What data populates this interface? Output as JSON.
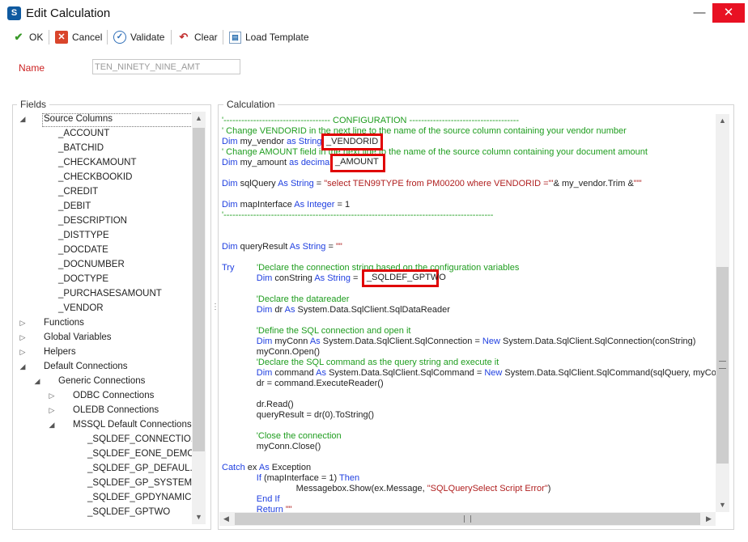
{
  "window": {
    "title": "Edit Calculation",
    "minimize_icon": "minimize-icon",
    "close_icon": "close-icon"
  },
  "toolbar": {
    "ok_label": "OK",
    "cancel_label": "Cancel",
    "validate_label": "Validate",
    "clear_label": "Clear",
    "load_template_label": "Load Template"
  },
  "name": {
    "label": "Name",
    "value": "TEN_NINETY_NINE_AMT"
  },
  "fields": {
    "label": "Fields",
    "source_columns": "Source Columns",
    "columns": [
      "_ACCOUNT",
      "_BATCHID",
      "_CHECKAMOUNT",
      "_CHECKBOOKID",
      "_CREDIT",
      "_DEBIT",
      "_DESCRIPTION",
      "_DISTTYPE",
      "_DOCDATE",
      "_DOCNUMBER",
      "_DOCTYPE",
      "_PURCHASESAMOUNT",
      "_VENDOR"
    ],
    "functions": "Functions",
    "global_variables": "Global Variables",
    "helpers": "Helpers",
    "default_connections": "Default Connections",
    "generic_connections": "Generic Connections",
    "odbc_connections": "ODBC Connections",
    "oledb_connections": "OLEDB Connections",
    "mssql_default_connections": "MSSQL Default Connections",
    "mssql_items": [
      "_SQLDEF_CONNECTIO...",
      "_SQLDEF_EONE_DEMO",
      "_SQLDEF_GP_DEFAUL...",
      "_SQLDEF_GP_SYSTEM...",
      "_SQLDEF_GPDYNAMICS",
      "_SQLDEF_GPTWO"
    ]
  },
  "calculation": {
    "label": "Calculation",
    "lines": [
      {
        "parts": [
          {
            "t": "'------------------------------------ CONFIGURATION -------------------------------------",
            "c": "cm"
          }
        ]
      },
      {
        "parts": [
          {
            "t": "' Change VENDORID in the next line to the name of the source column containing your vendor number",
            "c": "cm"
          }
        ]
      },
      {
        "parts": [
          {
            "t": "Dim ",
            "c": "kw"
          },
          {
            "t": "my_vendor ",
            "c": "tx"
          },
          {
            "t": "as String",
            "c": "kw"
          },
          {
            "t": " = ",
            "c": "tx"
          }
        ]
      },
      {
        "parts": [
          {
            "t": "' Change AMOUNT field in the next line to the name of the source column containing your document amount",
            "c": "cm"
          }
        ]
      },
      {
        "parts": [
          {
            "t": "Dim ",
            "c": "kw"
          },
          {
            "t": "my_amount ",
            "c": "tx"
          },
          {
            "t": "as decimal",
            "c": "kw"
          },
          {
            "t": " = ",
            "c": "tx"
          }
        ]
      },
      {
        "parts": []
      },
      {
        "parts": [
          {
            "t": "Dim ",
            "c": "kw"
          },
          {
            "t": "sqlQuery ",
            "c": "tx"
          },
          {
            "t": "As String",
            "c": "kw"
          },
          {
            "t": " = ",
            "c": "tx"
          },
          {
            "t": "\"select TEN99TYPE from PM00200 where VENDORID ='\"",
            "c": "st"
          },
          {
            "t": "& my_vendor.Trim &",
            "c": "tx"
          },
          {
            "t": "\"'\"",
            "c": "st"
          }
        ]
      },
      {
        "parts": []
      },
      {
        "parts": [
          {
            "t": "Dim ",
            "c": "kw"
          },
          {
            "t": "mapInterface ",
            "c": "tx"
          },
          {
            "t": "As Integer",
            "c": "kw"
          },
          {
            "t": " = 1",
            "c": "tx"
          }
        ]
      },
      {
        "parts": [
          {
            "t": "'-------------------------------------------------------------------------------------------",
            "c": "cm"
          }
        ]
      },
      {
        "parts": []
      },
      {
        "parts": []
      },
      {
        "parts": [
          {
            "t": "Dim ",
            "c": "kw"
          },
          {
            "t": "queryResult ",
            "c": "tx"
          },
          {
            "t": "As String",
            "c": "kw"
          },
          {
            "t": " = ",
            "c": "tx"
          },
          {
            "t": "\"\"",
            "c": "st"
          }
        ]
      },
      {
        "parts": []
      },
      {
        "parts": [
          {
            "t": "Try         ",
            "c": "kw"
          },
          {
            "t": "'Declare the connection string based on the configuration variables",
            "c": "cm"
          }
        ]
      },
      {
        "parts": [
          {
            "t": "              ",
            "c": "tx"
          },
          {
            "t": "Dim ",
            "c": "kw"
          },
          {
            "t": "conString ",
            "c": "tx"
          },
          {
            "t": "As String",
            "c": "kw"
          },
          {
            "t": " = ",
            "c": "tx"
          }
        ]
      },
      {
        "parts": []
      },
      {
        "parts": [
          {
            "t": "              ",
            "c": "tx"
          },
          {
            "t": "'Declare the datareader",
            "c": "cm"
          }
        ]
      },
      {
        "parts": [
          {
            "t": "              ",
            "c": "tx"
          },
          {
            "t": "Dim ",
            "c": "kw"
          },
          {
            "t": "dr ",
            "c": "tx"
          },
          {
            "t": "As ",
            "c": "kw"
          },
          {
            "t": "System.Data.SqlClient.SqlDataReader",
            "c": "tx"
          }
        ]
      },
      {
        "parts": []
      },
      {
        "parts": [
          {
            "t": "              ",
            "c": "tx"
          },
          {
            "t": "'Define the SQL connection and open it",
            "c": "cm"
          }
        ]
      },
      {
        "parts": [
          {
            "t": "              ",
            "c": "tx"
          },
          {
            "t": "Dim ",
            "c": "kw"
          },
          {
            "t": "myConn ",
            "c": "tx"
          },
          {
            "t": "As ",
            "c": "kw"
          },
          {
            "t": "System.Data.SqlClient.SqlConnection = ",
            "c": "tx"
          },
          {
            "t": "New ",
            "c": "kw"
          },
          {
            "t": "System.Data.SqlClient.SqlConnection(conString)",
            "c": "tx"
          }
        ]
      },
      {
        "parts": [
          {
            "t": "              myConn.Open()",
            "c": "tx"
          }
        ]
      },
      {
        "parts": [
          {
            "t": "              ",
            "c": "tx"
          },
          {
            "t": "'Declare the SQL command as the query string and execute it",
            "c": "cm"
          }
        ]
      },
      {
        "parts": [
          {
            "t": "              ",
            "c": "tx"
          },
          {
            "t": "Dim ",
            "c": "kw"
          },
          {
            "t": "command ",
            "c": "tx"
          },
          {
            "t": "As ",
            "c": "kw"
          },
          {
            "t": "System.Data.SqlClient.SqlCommand = ",
            "c": "tx"
          },
          {
            "t": "New ",
            "c": "kw"
          },
          {
            "t": "System.Data.SqlClient.SqlCommand(sqlQuery, myConn)",
            "c": "tx"
          }
        ]
      },
      {
        "parts": [
          {
            "t": "              dr = command.ExecuteReader()",
            "c": "tx"
          }
        ]
      },
      {
        "parts": []
      },
      {
        "parts": [
          {
            "t": "              dr.Read()",
            "c": "tx"
          }
        ]
      },
      {
        "parts": [
          {
            "t": "              queryResult = dr(0).ToString()",
            "c": "tx"
          }
        ]
      },
      {
        "parts": []
      },
      {
        "parts": [
          {
            "t": "              ",
            "c": "tx"
          },
          {
            "t": "'Close the connection",
            "c": "cm"
          }
        ]
      },
      {
        "parts": [
          {
            "t": "              myConn.Close()",
            "c": "tx"
          }
        ]
      },
      {
        "parts": []
      },
      {
        "parts": [
          {
            "t": "Catch ",
            "c": "kw"
          },
          {
            "t": "ex ",
            "c": "tx"
          },
          {
            "t": "As ",
            "c": "kw"
          },
          {
            "t": "Exception",
            "c": "tx"
          }
        ]
      },
      {
        "parts": [
          {
            "t": "              ",
            "c": "tx"
          },
          {
            "t": "If ",
            "c": "kw"
          },
          {
            "t": "(mapInterface = 1) ",
            "c": "tx"
          },
          {
            "t": "Then",
            "c": "kw"
          }
        ]
      },
      {
        "parts": [
          {
            "t": "                              Messagebox.Show(ex.Message, ",
            "c": "tx"
          },
          {
            "t": "\"SQLQuerySelect Script Error\"",
            "c": "st"
          },
          {
            "t": ")",
            "c": "tx"
          }
        ]
      },
      {
        "parts": [
          {
            "t": "              ",
            "c": "tx"
          },
          {
            "t": "End If",
            "c": "kw"
          }
        ]
      },
      {
        "parts": [
          {
            "t": "              ",
            "c": "tx"
          },
          {
            "t": "Return ",
            "c": "kw"
          },
          {
            "t": "\"\"",
            "c": "st"
          }
        ]
      }
    ],
    "highlights": {
      "vendor": "_VENDORID",
      "amount": "_AMOUNT",
      "conn": "_SQLDEF_GPTWO"
    }
  },
  "colors": {
    "accent_red": "#e00000",
    "comment": "#1f9d1f",
    "keyword": "#1f3fe0",
    "string": "#b01f1f"
  }
}
